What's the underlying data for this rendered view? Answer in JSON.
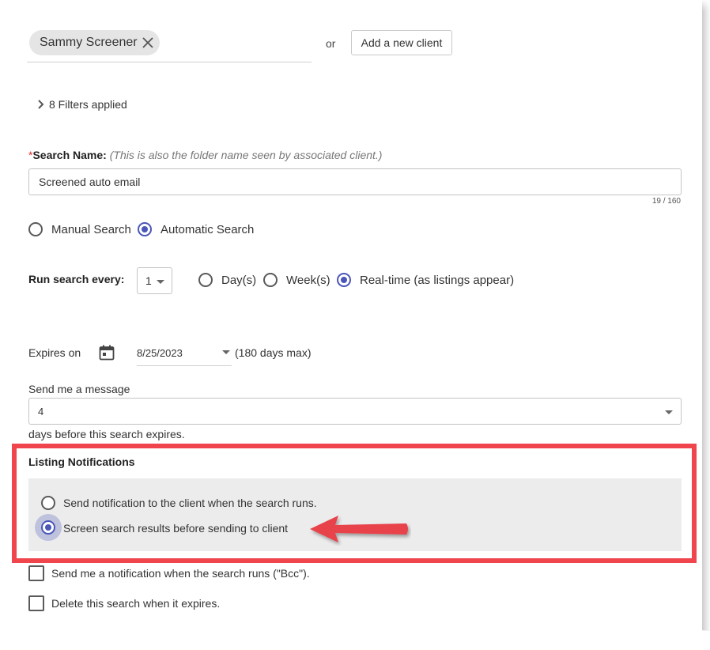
{
  "client": {
    "chip_label": "Sammy Screener",
    "or_text": "or",
    "add_button": "Add a new client"
  },
  "filters": {
    "label": "8 Filters applied"
  },
  "search_name": {
    "required_mark": "*",
    "label": "Search Name:",
    "hint": "(This is also the folder name seen by associated client.)",
    "value": "Screened auto email",
    "counter": "19 / 160"
  },
  "search_type": {
    "options": [
      {
        "label": "Manual Search",
        "selected": false
      },
      {
        "label": "Automatic Search",
        "selected": true
      }
    ]
  },
  "run_search": {
    "label": "Run search every:",
    "interval_value": "1",
    "units": [
      {
        "label": "Day(s)",
        "selected": false
      },
      {
        "label": "Week(s)",
        "selected": false
      },
      {
        "label": "Real-time (as listings appear)",
        "selected": true
      }
    ]
  },
  "expires": {
    "label": "Expires on",
    "date": "8/25/2023",
    "max_note": "(180 days max)"
  },
  "reminder": {
    "label": "Send me a message",
    "value": "4",
    "suffix": "days before this search expires."
  },
  "listing_notifications": {
    "title": "Listing Notifications",
    "options": [
      {
        "label": "Send notification to the client when the search runs.",
        "selected": false
      },
      {
        "label": "Screen search results before sending to client",
        "selected": true
      }
    ]
  },
  "checkboxes": [
    {
      "label": "Send me a notification when the search runs (\"Bcc\").",
      "checked": false
    },
    {
      "label": "Delete this search when it expires.",
      "checked": false
    }
  ],
  "colors": {
    "accent": "#4a56b8",
    "highlight_border": "#f0454d",
    "arrow": "#e8434b",
    "panel_bg": "#ececec",
    "required": "#d9342b"
  },
  "icons": {
    "chip_remove": "close-icon",
    "filters_toggle": "chevron-right-icon",
    "date_picker": "calendar-icon",
    "dropdown": "caret-down-icon",
    "annotation": "arrow-left-icon"
  }
}
